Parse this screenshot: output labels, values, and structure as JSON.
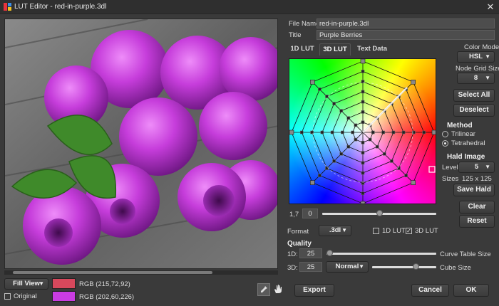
{
  "window": {
    "title": "LUT Editor - red-in-purple.3dl",
    "close_glyph": "✕"
  },
  "file": {
    "label": "File Name",
    "value": "red-in-purple.3dl"
  },
  "title_field": {
    "label": "Title",
    "value": "Purple Berries"
  },
  "tabs": [
    {
      "label": "1D LUT",
      "active": false
    },
    {
      "label": "3D LUT",
      "active": true
    },
    {
      "label": "Text Data",
      "active": false
    }
  ],
  "color_model": {
    "label": "Color Model",
    "value": "HSL"
  },
  "node_grid": {
    "label": "Node Grid Size",
    "value": "8"
  },
  "buttons": {
    "select_all": "Select All",
    "deselect": "Deselect",
    "save_hald": "Save Hald",
    "clear": "Clear",
    "reset": "Reset",
    "export": "Export",
    "cancel": "Cancel",
    "ok": "OK"
  },
  "method": {
    "label": "Method",
    "options": [
      "Trilinear",
      "Tetrahedral"
    ],
    "selected": "Tetrahedral"
  },
  "hald": {
    "label": "Hald Image",
    "level_label": "Level",
    "level_value": "5",
    "sizes_label": "Sizes",
    "sizes_value": "125 x 125"
  },
  "gamma": {
    "label": "1,7",
    "value": "0",
    "slider": 0.5
  },
  "format": {
    "label": "Format",
    "value": ".3dl"
  },
  "lut_toggles": {
    "lut1d": "1D LUT",
    "lut3d": "3D LUT",
    "lut1d_checked": false,
    "lut3d_checked": true
  },
  "quality": {
    "label": "Quality",
    "d1_label": "1D:",
    "d1_value": "25",
    "d1_caption": "Curve Table Size",
    "d1_slider": 0.0,
    "d3_label": "3D:",
    "d3_value": "25",
    "d3_mode": "Normal",
    "d3_caption": "Cube Size",
    "d3_slider": 0.7
  },
  "bottom": {
    "view_mode": "Fill View",
    "original_label": "Original",
    "original_checked": false,
    "swatch1": {
      "label": "RGB (215,72,92)",
      "color": "#d7485c"
    },
    "swatch2": {
      "label": "RGB (202,60,226)",
      "color": "#ca3ce2"
    }
  },
  "colors": {
    "accent_photo_berry": "#c13fd6",
    "leaf": "#3f8a2a",
    "wood": "#6f6f6f"
  }
}
